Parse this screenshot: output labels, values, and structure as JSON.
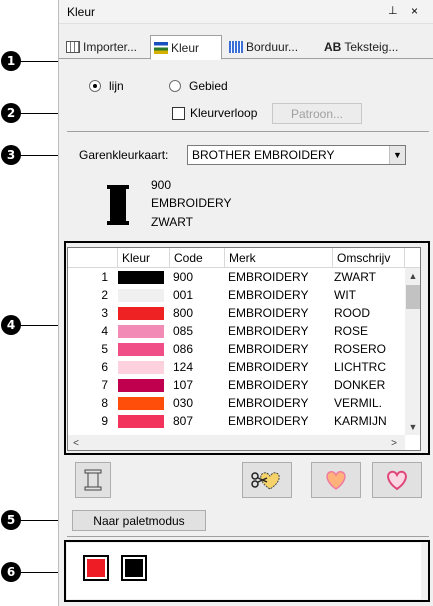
{
  "panel": {
    "title": "Kleur",
    "pin_glyph": "⊥",
    "close_glyph": "×"
  },
  "tabs": [
    {
      "label": "Importer...",
      "icon": "import-icon",
      "active": false
    },
    {
      "label": "Kleur",
      "icon": "color-icon",
      "active": true
    },
    {
      "label": "Borduur...",
      "icon": "embroidery-icon",
      "active": false
    },
    {
      "label": "Teksteig...",
      "icon": "text-ab-icon",
      "active": false
    }
  ],
  "tab_ab_glyph": "AB",
  "mode": {
    "line_label": "lijn",
    "area_label": "Gebied",
    "selected": "lijn"
  },
  "gradient": {
    "label": "Kleurverloop",
    "checked": false,
    "pattern_button": "Patroon..."
  },
  "chart": {
    "label": "Garenkleurkaart:",
    "selected": "BROTHER EMBROIDERY"
  },
  "current_thread": {
    "code": "900",
    "brand": "EMBROIDERY",
    "name": "ZWART",
    "color": "#000000"
  },
  "table": {
    "headers": [
      "Kleur",
      "Code",
      "Merk",
      "Omschrijv"
    ],
    "rows": [
      {
        "num": "1",
        "color": "#000000",
        "code": "900",
        "merk": "EMBROIDERY",
        "omschrijving": "ZWART"
      },
      {
        "num": "2",
        "color": "#f0f0f0",
        "code": "001",
        "merk": "EMBROIDERY",
        "omschrijving": "WIT"
      },
      {
        "num": "3",
        "color": "#ee2222",
        "code": "800",
        "merk": "EMBROIDERY",
        "omschrijving": "ROOD"
      },
      {
        "num": "4",
        "color": "#f28bb5",
        "code": "085",
        "merk": "EMBROIDERY",
        "omschrijving": "ROSE"
      },
      {
        "num": "5",
        "color": "#ef4e86",
        "code": "086",
        "merk": "EMBROIDERY",
        "omschrijving": "ROSERO"
      },
      {
        "num": "6",
        "color": "#fdd2de",
        "code": "124",
        "merk": "EMBROIDERY",
        "omschrijving": "LICHTRC"
      },
      {
        "num": "7",
        "color": "#c0004f",
        "code": "107",
        "merk": "EMBROIDERY",
        "omschrijving": "DONKER"
      },
      {
        "num": "8",
        "color": "#ff4d0a",
        "code": "030",
        "merk": "EMBROIDERY",
        "omschrijving": "VERMIL."
      },
      {
        "num": "9",
        "color": "#f2345c",
        "code": "807",
        "merk": "EMBROIDERY",
        "omschrijving": "KARMIJN"
      }
    ]
  },
  "palette_button": "Naar paletmodus",
  "palette": [
    "#ee1c24",
    "#000000"
  ],
  "callouts": [
    "1",
    "2",
    "3",
    "4",
    "5",
    "6"
  ],
  "colors": {
    "panel_bg": "#f0f0f0",
    "frame": "#000000",
    "heart_orange": "#ffb37a",
    "heart_pink": "#f07aa0"
  }
}
